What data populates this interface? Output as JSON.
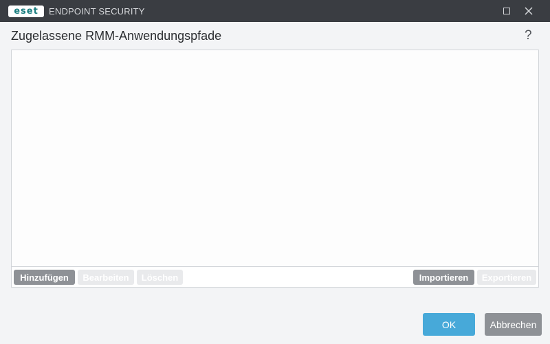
{
  "titlebar": {
    "logo_text": "eset",
    "product_name": "ENDPOINT SECURITY",
    "maximize_icon": "maximize-icon",
    "close_icon": "close-icon"
  },
  "dialog": {
    "title": "Zugelassene RMM-Anwendungspfade",
    "help_label": "?"
  },
  "list": {
    "items": [],
    "buttons": {
      "add": "Hinzufügen",
      "edit": "Bearbeiten",
      "delete": "Löschen",
      "import": "Importieren",
      "export": "Exportieren"
    }
  },
  "footer": {
    "ok": "OK",
    "cancel": "Abbrechen"
  },
  "colors": {
    "titlebar": "#3a3d42",
    "accent": "#47a9d9",
    "button_gray": "#8e9196",
    "logo_teal": "#1b7e80"
  }
}
